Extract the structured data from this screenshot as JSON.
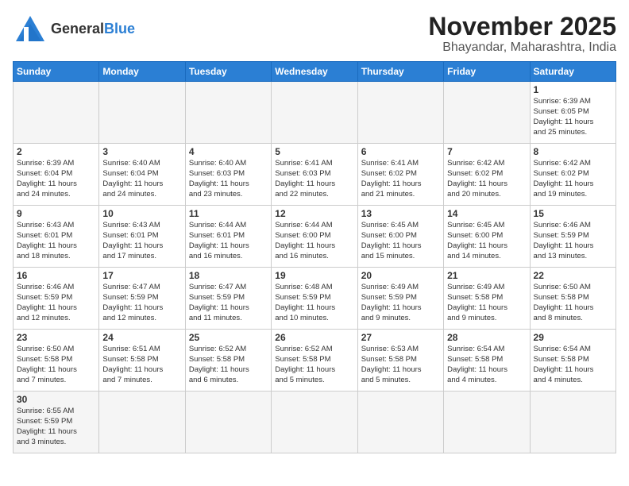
{
  "header": {
    "logo_general": "General",
    "logo_blue": "Blue",
    "month": "November 2025",
    "location": "Bhayandar, Maharashtra, India"
  },
  "days_of_week": [
    "Sunday",
    "Monday",
    "Tuesday",
    "Wednesday",
    "Thursday",
    "Friday",
    "Saturday"
  ],
  "weeks": [
    [
      {
        "day": "",
        "info": ""
      },
      {
        "day": "",
        "info": ""
      },
      {
        "day": "",
        "info": ""
      },
      {
        "day": "",
        "info": ""
      },
      {
        "day": "",
        "info": ""
      },
      {
        "day": "",
        "info": ""
      },
      {
        "day": "1",
        "info": "Sunrise: 6:39 AM\nSunset: 6:05 PM\nDaylight: 11 hours\nand 25 minutes."
      }
    ],
    [
      {
        "day": "2",
        "info": "Sunrise: 6:39 AM\nSunset: 6:04 PM\nDaylight: 11 hours\nand 24 minutes."
      },
      {
        "day": "3",
        "info": "Sunrise: 6:40 AM\nSunset: 6:04 PM\nDaylight: 11 hours\nand 24 minutes."
      },
      {
        "day": "4",
        "info": "Sunrise: 6:40 AM\nSunset: 6:03 PM\nDaylight: 11 hours\nand 23 minutes."
      },
      {
        "day": "5",
        "info": "Sunrise: 6:41 AM\nSunset: 6:03 PM\nDaylight: 11 hours\nand 22 minutes."
      },
      {
        "day": "6",
        "info": "Sunrise: 6:41 AM\nSunset: 6:02 PM\nDaylight: 11 hours\nand 21 minutes."
      },
      {
        "day": "7",
        "info": "Sunrise: 6:42 AM\nSunset: 6:02 PM\nDaylight: 11 hours\nand 20 minutes."
      },
      {
        "day": "8",
        "info": "Sunrise: 6:42 AM\nSunset: 6:02 PM\nDaylight: 11 hours\nand 19 minutes."
      }
    ],
    [
      {
        "day": "9",
        "info": "Sunrise: 6:43 AM\nSunset: 6:01 PM\nDaylight: 11 hours\nand 18 minutes."
      },
      {
        "day": "10",
        "info": "Sunrise: 6:43 AM\nSunset: 6:01 PM\nDaylight: 11 hours\nand 17 minutes."
      },
      {
        "day": "11",
        "info": "Sunrise: 6:44 AM\nSunset: 6:01 PM\nDaylight: 11 hours\nand 16 minutes."
      },
      {
        "day": "12",
        "info": "Sunrise: 6:44 AM\nSunset: 6:00 PM\nDaylight: 11 hours\nand 16 minutes."
      },
      {
        "day": "13",
        "info": "Sunrise: 6:45 AM\nSunset: 6:00 PM\nDaylight: 11 hours\nand 15 minutes."
      },
      {
        "day": "14",
        "info": "Sunrise: 6:45 AM\nSunset: 6:00 PM\nDaylight: 11 hours\nand 14 minutes."
      },
      {
        "day": "15",
        "info": "Sunrise: 6:46 AM\nSunset: 5:59 PM\nDaylight: 11 hours\nand 13 minutes."
      }
    ],
    [
      {
        "day": "16",
        "info": "Sunrise: 6:46 AM\nSunset: 5:59 PM\nDaylight: 11 hours\nand 12 minutes."
      },
      {
        "day": "17",
        "info": "Sunrise: 6:47 AM\nSunset: 5:59 PM\nDaylight: 11 hours\nand 12 minutes."
      },
      {
        "day": "18",
        "info": "Sunrise: 6:47 AM\nSunset: 5:59 PM\nDaylight: 11 hours\nand 11 minutes."
      },
      {
        "day": "19",
        "info": "Sunrise: 6:48 AM\nSunset: 5:59 PM\nDaylight: 11 hours\nand 10 minutes."
      },
      {
        "day": "20",
        "info": "Sunrise: 6:49 AM\nSunset: 5:59 PM\nDaylight: 11 hours\nand 9 minutes."
      },
      {
        "day": "21",
        "info": "Sunrise: 6:49 AM\nSunset: 5:58 PM\nDaylight: 11 hours\nand 9 minutes."
      },
      {
        "day": "22",
        "info": "Sunrise: 6:50 AM\nSunset: 5:58 PM\nDaylight: 11 hours\nand 8 minutes."
      }
    ],
    [
      {
        "day": "23",
        "info": "Sunrise: 6:50 AM\nSunset: 5:58 PM\nDaylight: 11 hours\nand 7 minutes."
      },
      {
        "day": "24",
        "info": "Sunrise: 6:51 AM\nSunset: 5:58 PM\nDaylight: 11 hours\nand 7 minutes."
      },
      {
        "day": "25",
        "info": "Sunrise: 6:52 AM\nSunset: 5:58 PM\nDaylight: 11 hours\nand 6 minutes."
      },
      {
        "day": "26",
        "info": "Sunrise: 6:52 AM\nSunset: 5:58 PM\nDaylight: 11 hours\nand 5 minutes."
      },
      {
        "day": "27",
        "info": "Sunrise: 6:53 AM\nSunset: 5:58 PM\nDaylight: 11 hours\nand 5 minutes."
      },
      {
        "day": "28",
        "info": "Sunrise: 6:54 AM\nSunset: 5:58 PM\nDaylight: 11 hours\nand 4 minutes."
      },
      {
        "day": "29",
        "info": "Sunrise: 6:54 AM\nSunset: 5:58 PM\nDaylight: 11 hours\nand 4 minutes."
      }
    ],
    [
      {
        "day": "30",
        "info": "Sunrise: 6:55 AM\nSunset: 5:59 PM\nDaylight: 11 hours\nand 3 minutes."
      },
      {
        "day": "",
        "info": ""
      },
      {
        "day": "",
        "info": ""
      },
      {
        "day": "",
        "info": ""
      },
      {
        "day": "",
        "info": ""
      },
      {
        "day": "",
        "info": ""
      },
      {
        "day": "",
        "info": ""
      }
    ]
  ]
}
